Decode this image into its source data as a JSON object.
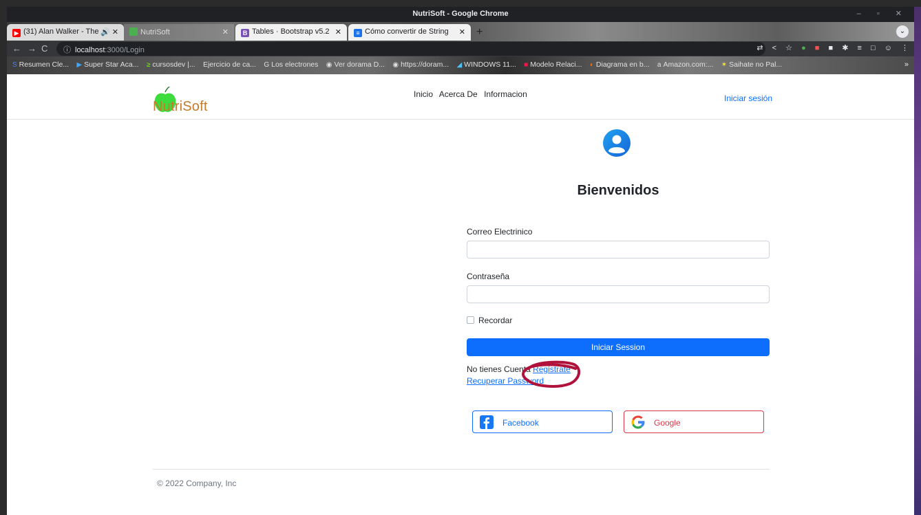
{
  "window": {
    "title": "NutriSoft - Google Chrome",
    "controls": "–  ▫  ✕"
  },
  "tabs": [
    {
      "label": "(31) Alan Walker - The",
      "icon": "youtube-icon",
      "extra": "🔊"
    },
    {
      "label": "NutriSoft",
      "icon": "nutrisoft-favicon"
    },
    {
      "label": "Tables · Bootstrap v5.2",
      "icon": "bootstrap-icon"
    },
    {
      "label": "Cómo convertir de String",
      "icon": "docs-icon"
    }
  ],
  "toolbar": {
    "url_host": "localhost",
    "url_path": ":3000/Login"
  },
  "bookmarks": [
    "Resumen Cle...",
    "Super Star Aca...",
    "cursosdev |...",
    "Ejercicio de ca...",
    "Los electrones",
    "Ver dorama D...",
    "https://doram...",
    "WINDOWS 11...",
    "Modelo Relaci...",
    "Diagrama en b...",
    "Amazon.com:...",
    "Saihate no Pal..."
  ],
  "navbar": {
    "brand": "NutriSoft",
    "links": [
      "Inicio",
      "Acerca De",
      "Informacion"
    ],
    "login": "Iniciar sesión"
  },
  "login": {
    "heading": "Bienvenidos",
    "email_label": "Correo Electrinico",
    "password_label": "Contraseña",
    "remember_label": "Recordar",
    "submit_label": "Iniciar Session",
    "no_account_text": "No tienes Cuenta",
    "register_link": "Registrate",
    "recover_link": "Recuperar Password",
    "facebook_label": "Facebook",
    "google_label": "Google"
  },
  "footer": {
    "text": "© 2022 Company, Inc"
  },
  "colors": {
    "primary": "#0d6efd",
    "danger": "#dc3545",
    "brand": "#c77a2a",
    "annotation": "#b0123c"
  }
}
